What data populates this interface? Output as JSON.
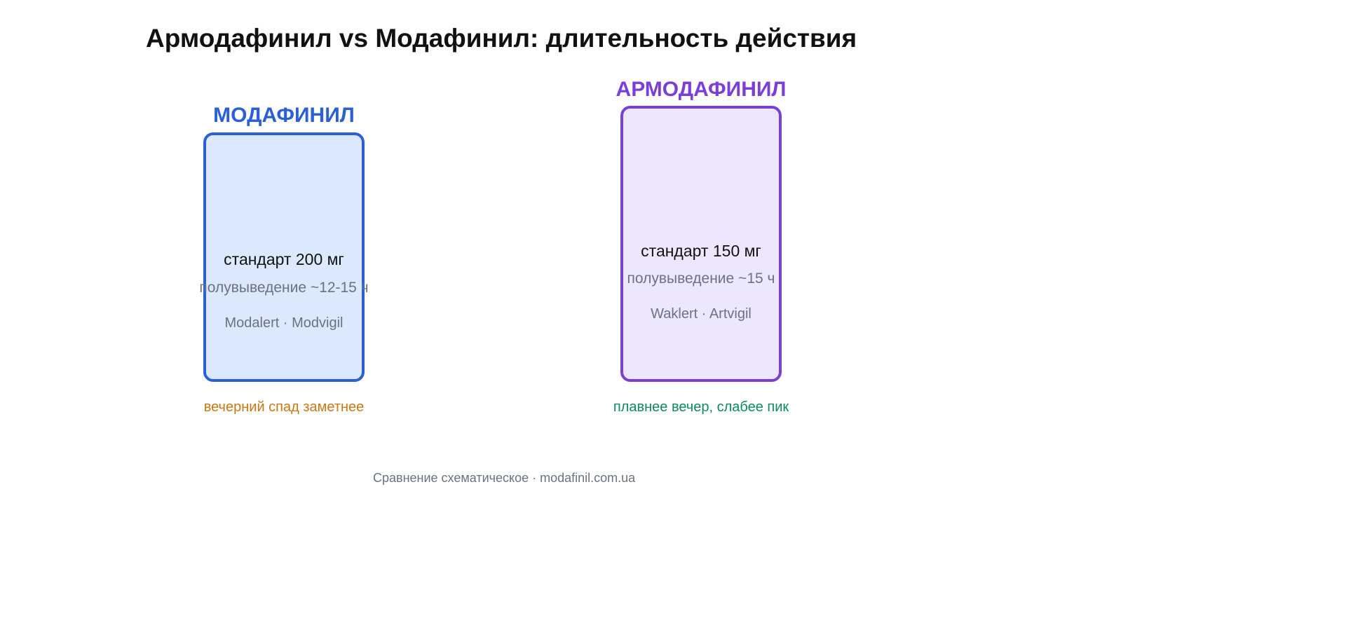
{
  "title": "Армодафинил vs Модафинил: длительность действия",
  "modafinil": {
    "label": "МОДАФИНИЛ",
    "dose": "стандарт 200 мг",
    "half_life": "полувыведение ~12-15 ч",
    "brands": "Modalert · Modvigil",
    "note": "вечерний спад заметнее",
    "color": "#2a5fd8",
    "fill": "#dbe8fd",
    "note_color": "#c87812"
  },
  "armodafinil": {
    "label": "АРМОДАФИНИЛ",
    "dose": "стандарт 150 мг",
    "half_life": "полувыведение ~15 ч",
    "brands": "Waklert · Artvigil",
    "note": "плавнее вечер, слабее пик",
    "color": "#7a3fd8",
    "fill": "#ece7fd",
    "note_color": "#0e8a5f"
  },
  "footer": "Сравнение схематическое · modafinil.com.ua"
}
